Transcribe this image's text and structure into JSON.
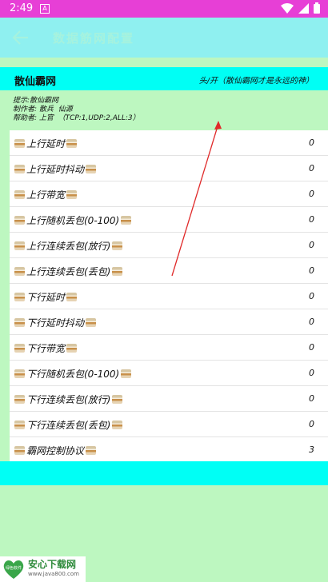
{
  "status": {
    "time": "2:49",
    "notif": "A"
  },
  "app_bar": {
    "title": "数据筋网配置"
  },
  "header": {
    "left": "散仙霸网",
    "right": "头/开（散仙霸网才是永远的神）"
  },
  "info": {
    "line1": "提示:散仙霸网",
    "line2": "制作者: 散兵  仙源",
    "line3": "帮助者: 上官  （TCP:1,UDP:2,ALL:3）"
  },
  "rows": [
    {
      "label": "上行延时",
      "value": "0"
    },
    {
      "label": "上行延时抖动",
      "value": "0"
    },
    {
      "label": "上行带宽",
      "value": "0"
    },
    {
      "label": "上行随机丢包(0-100)",
      "value": "0"
    },
    {
      "label": "上行连续丢包(放行)",
      "value": "0"
    },
    {
      "label": "上行连续丢包(丢包)",
      "value": "0"
    },
    {
      "label": "下行延时",
      "value": "0"
    },
    {
      "label": "下行延时抖动",
      "value": "0"
    },
    {
      "label": "下行带宽",
      "value": "0"
    },
    {
      "label": "下行随机丢包(0-100)",
      "value": "0"
    },
    {
      "label": "下行连续丢包(放行)",
      "value": "0"
    },
    {
      "label": "下行连续丢包(丢包)",
      "value": "0"
    },
    {
      "label": "霸网控制协议",
      "value": "3"
    }
  ],
  "watermark": {
    "name": "安心下载网",
    "url": "www.java800.com",
    "logo_text": "绿色软件"
  },
  "colors": {
    "status_bar": "#e73fd6",
    "app_bar": "#8ff0f0",
    "header": "#00fff5",
    "background": "#bdf7c0",
    "arrow": "#e02a2a"
  }
}
